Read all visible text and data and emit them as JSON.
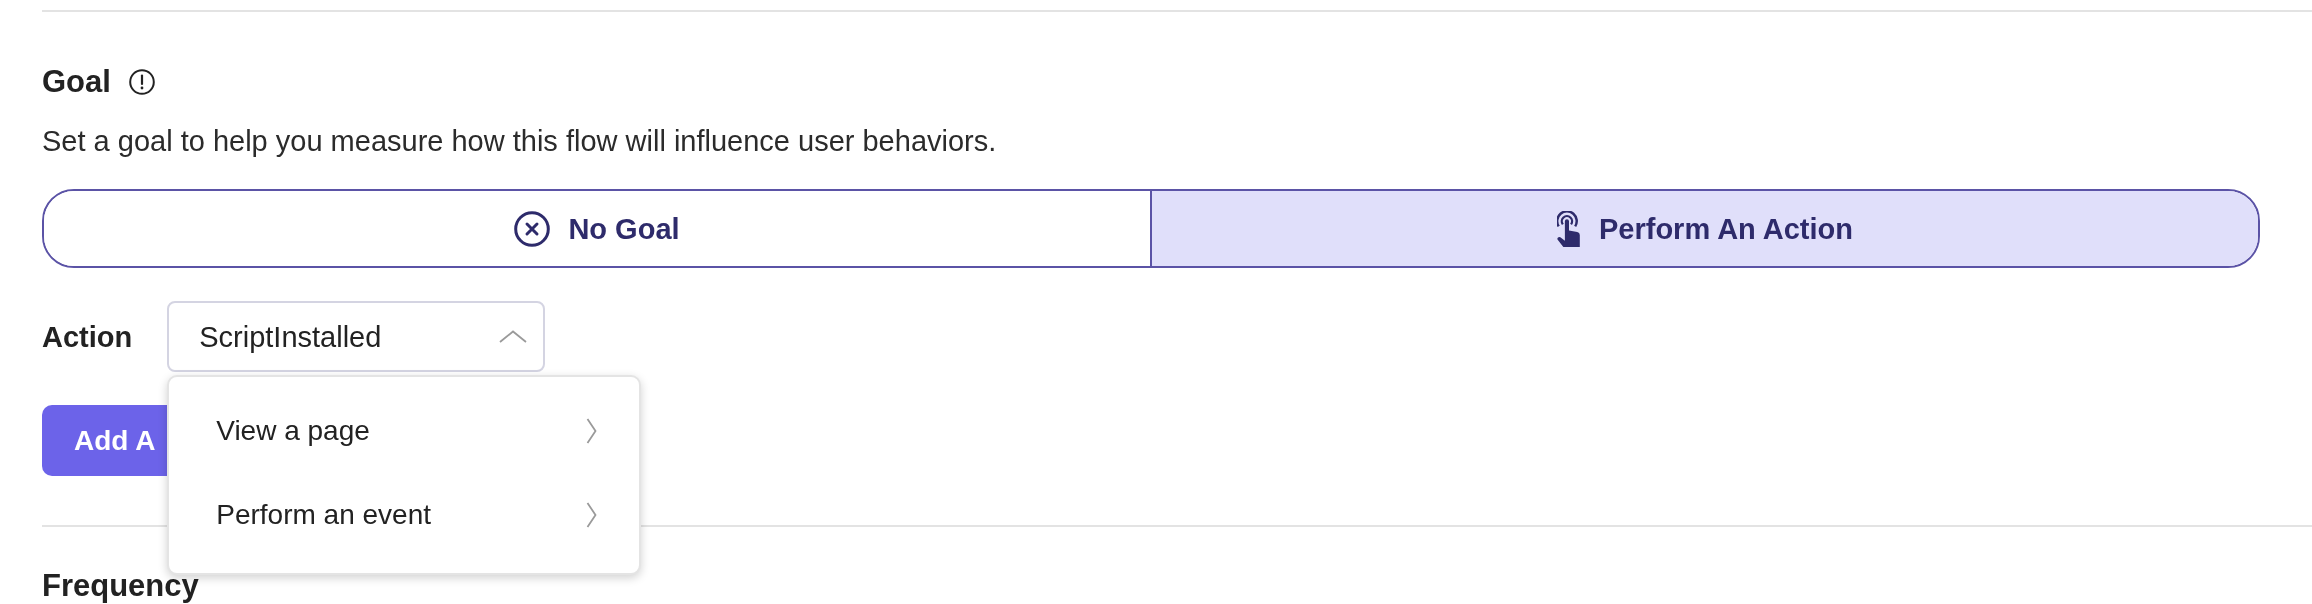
{
  "goal": {
    "title": "Goal",
    "description": "Set a goal to help you measure how this flow will influence user behaviors."
  },
  "goal_options": [
    {
      "label": "No Goal",
      "kind": "none",
      "selected": false
    },
    {
      "label": "Perform An Action",
      "kind": "action",
      "selected": true
    }
  ],
  "action": {
    "label": "Action",
    "value": "ScriptInstalled",
    "expanded": true,
    "menu": [
      {
        "label": "View a page"
      },
      {
        "label": "Perform an event"
      }
    ]
  },
  "add_button": {
    "label": "Add A"
  },
  "next_section": {
    "title": "Frequency"
  }
}
